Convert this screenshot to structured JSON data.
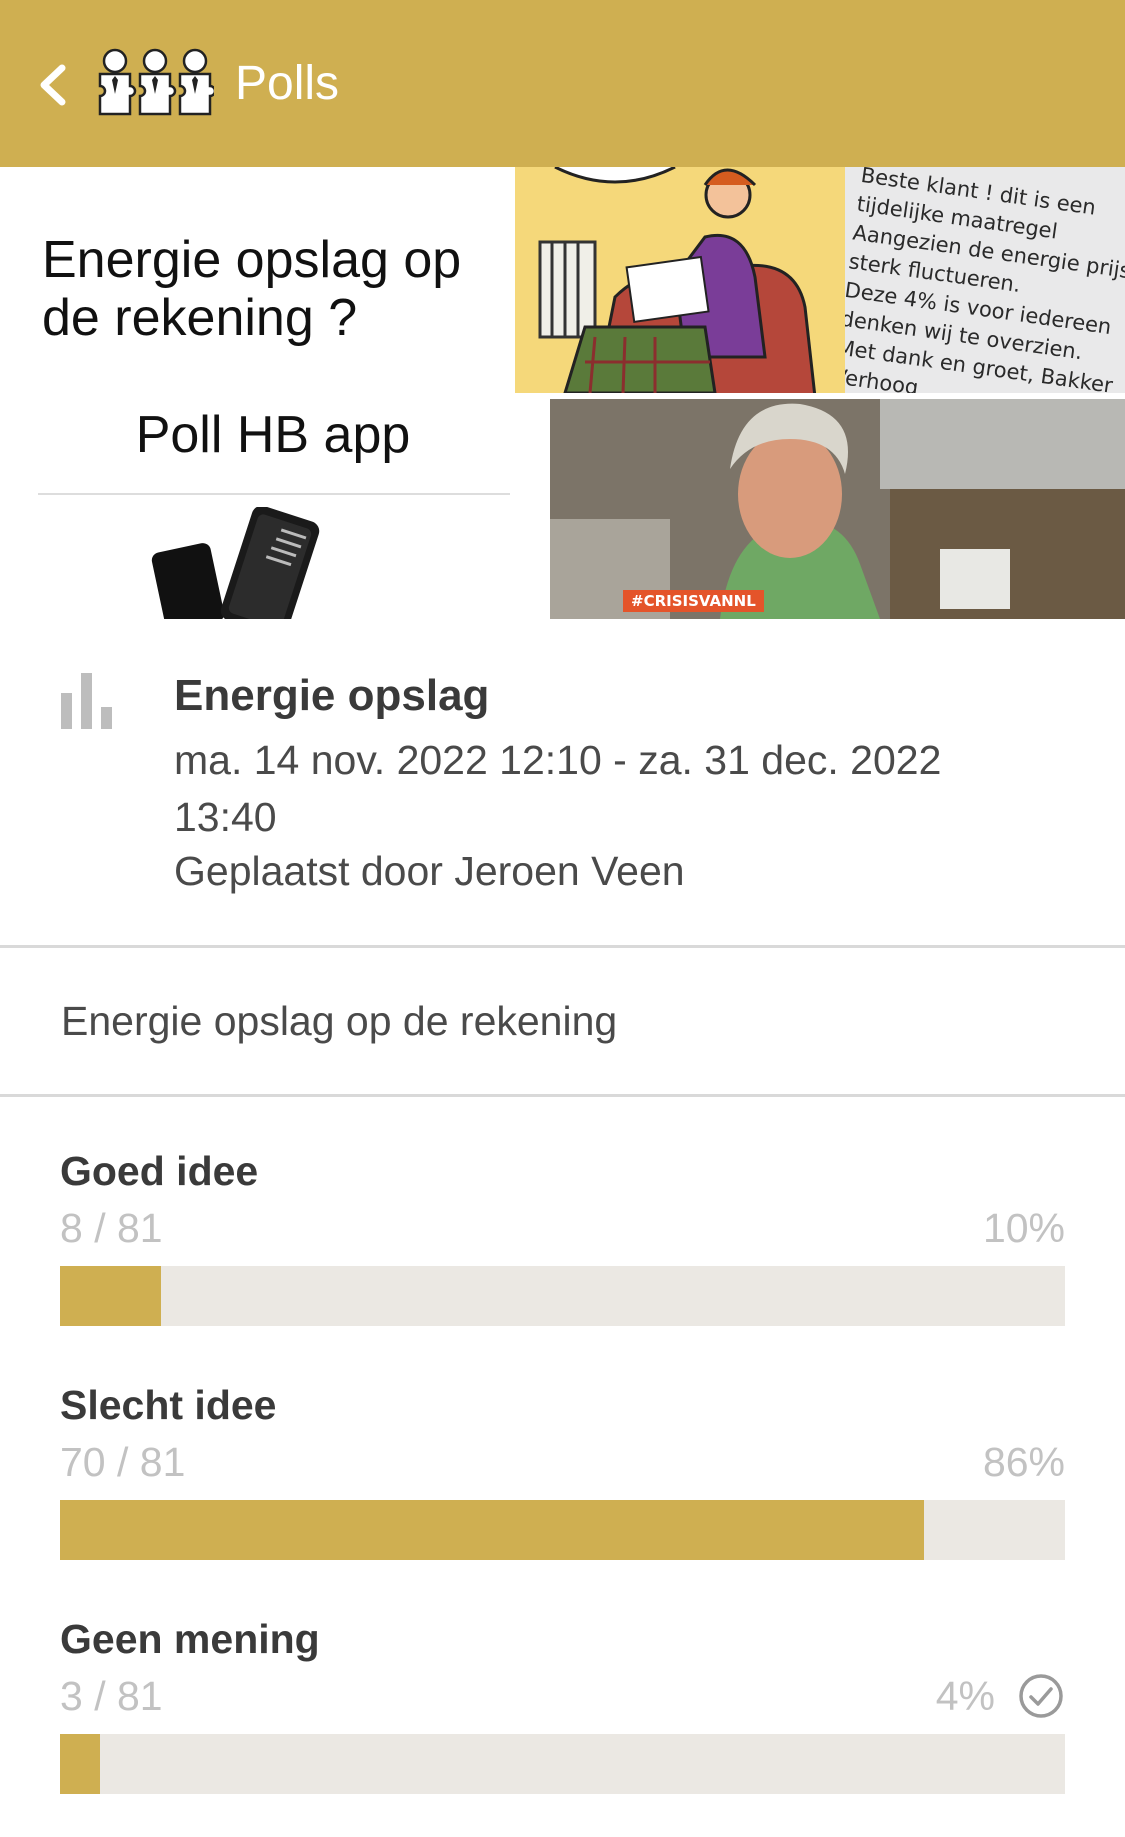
{
  "header": {
    "title": "Polls",
    "background_color": "#cfaf51"
  },
  "banner": {
    "title": "Energie opslag op de rekening ?",
    "subtitle": "Poll HB app",
    "letter_text": [
      "Beste klant ! dit is een",
      "tijdelijke maatregel",
      "Aangezien de energie prijs",
      "sterk fluctueren.",
      "Deze 4% is voor iedereen",
      "denken wij te overzien.",
      "Met dank en groet, Bakker",
      "Verhoog"
    ],
    "photo_tag": "#CRISISVANNL"
  },
  "poll": {
    "title": "Energie opslag",
    "dates": "ma. 14 nov. 2022 12:10 - za. 31 dec. 2022 13:40",
    "author": "Geplaatst door Jeroen Veen",
    "question": "Energie opslag op de rekening"
  },
  "options": [
    {
      "label": "Goed idee",
      "count": "8 / 81",
      "percent": "10%",
      "fraction": 0.1
    },
    {
      "label": "Slecht idee",
      "count": "70 / 81",
      "percent": "86%",
      "fraction": 0.86
    },
    {
      "label": "Geen mening",
      "count": "3 / 81",
      "percent": "4%",
      "fraction": 0.04,
      "selected": true
    }
  ],
  "icons": [
    "back-arrow-icon",
    "logo-icon",
    "bar-chart-icon",
    "check-circle-icon"
  ],
  "colors": {
    "accent": "#cfaf51",
    "track": "#ebe8e3",
    "muted": "#c2c2c2"
  }
}
